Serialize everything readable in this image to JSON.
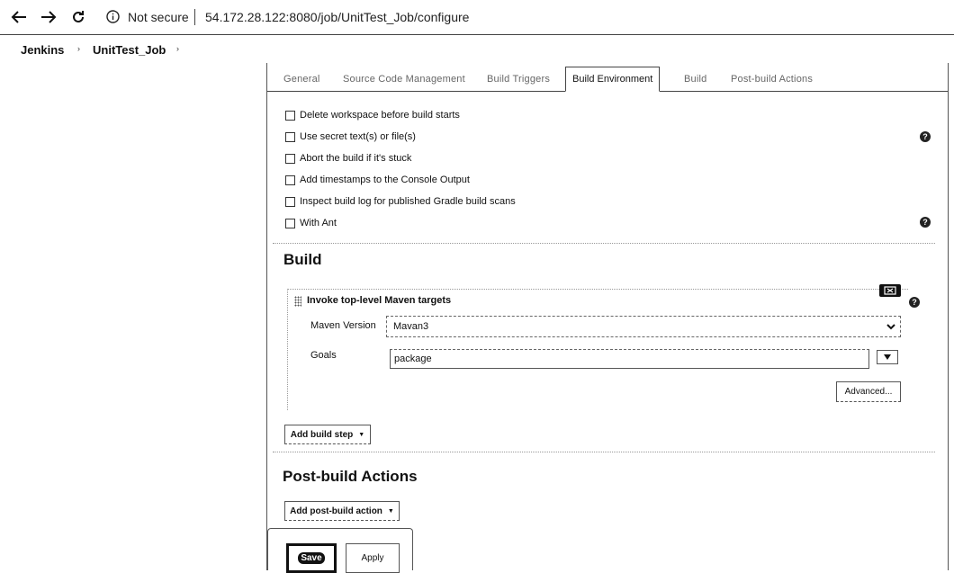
{
  "browser": {
    "security_label": "Not secure",
    "url": "54.172.28.122:8080/job/UnitTest_Job/configure"
  },
  "breadcrumb": {
    "items": [
      "Jenkins",
      "UnitTest_Job"
    ]
  },
  "tabs": [
    {
      "label": "General",
      "active": false
    },
    {
      "label": "Source Code Management",
      "active": false
    },
    {
      "label": "Build Triggers",
      "active": false
    },
    {
      "label": "Build Environment",
      "active": true
    },
    {
      "label": "Build",
      "active": false
    },
    {
      "label": "Post-build Actions",
      "active": false
    }
  ],
  "build_environment": {
    "options": [
      {
        "label": "Delete workspace before build starts",
        "checked": false
      },
      {
        "label": "Use secret text(s) or file(s)",
        "checked": false
      },
      {
        "label": "Abort the build if it's stuck",
        "checked": false
      },
      {
        "label": "Add timestamps to the Console Output",
        "checked": false
      },
      {
        "label": "Inspect build log for published Gradle build scans",
        "checked": false
      },
      {
        "label": "With Ant",
        "checked": false
      }
    ]
  },
  "build": {
    "title": "Build",
    "step_title": "Invoke top-level Maven targets",
    "maven_version_label": "Maven Version",
    "maven_version_value": "Mavan3",
    "goals_label": "Goals",
    "goals_value": "package",
    "advanced_label": "Advanced...",
    "add_step_label": "Add build step"
  },
  "post_build": {
    "title": "Post-build Actions",
    "add_action_label": "Add post-build action"
  },
  "actions": {
    "save_label": "Save",
    "apply_label": "Apply"
  },
  "help_glyph": "?",
  "icons": [
    "back-arrow-icon",
    "forward-arrow-icon",
    "reload-icon",
    "info-icon",
    "help-icon",
    "delete-step-icon",
    "drag-handle-icon",
    "chevron-down-icon",
    "expand-icon"
  ]
}
